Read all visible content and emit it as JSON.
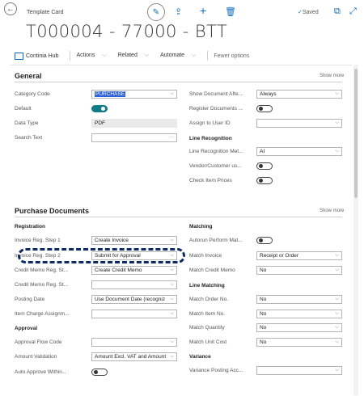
{
  "breadcrumb": "Template Card",
  "title": "T000004 - 77000 - BTT",
  "saved": "Saved",
  "actions": {
    "hub": "Continia Hub",
    "actions": "Actions",
    "related": "Related",
    "automate": "Automate",
    "fewer": "Fewer options"
  },
  "general": {
    "title": "General",
    "show_more": "Show more",
    "category_code_label": "Category Code",
    "category_code": "PURCHASE",
    "default_label": "Default",
    "data_type_label": "Data Type",
    "data_type": "PDF",
    "search_text_label": "Search Text",
    "show_doc_after_label": "Show Document Afte...",
    "show_doc_after": "Always",
    "register_docs_label": "Register Documents ...",
    "assign_user_label": "Assign to User ID",
    "line_recognition": "Line Recognition",
    "line_recog_method_label": "Line Recognition Met...",
    "line_recog_method": "AI",
    "vendor_customer_label": "Vendor/Customer us...",
    "check_item_prices_label": "Check Item Prices"
  },
  "purchase": {
    "title": "Purchase Documents",
    "show_more": "Show more",
    "registration": "Registration",
    "inv_step1_label": "Invoice Reg. Step 1",
    "inv_step1": "Create Invoice",
    "inv_step2_label": "Invoice Reg. Step 2",
    "inv_step2": "Submit for Approval",
    "cm_step1_label": "Credit Memo Reg. St...",
    "cm_step1": "Create Credit Memo",
    "cm_step2_label": "Credit Memo Reg. St...",
    "posting_date_label": "Posting Date",
    "posting_date": "Use Document Date (recogniz",
    "item_charge_label": "Item Charge Assignm...",
    "approval": "Approval",
    "approval_flow_label": "Approval Flow Code",
    "amount_validation_label": "Amount Validation",
    "amount_validation": "Amount Excl. VAT and Amount",
    "auto_approve_label": "Auto Approve Within...",
    "matching": "Matching",
    "autorun_label": "Autorun Perform Mat...",
    "match_invoice_label": "Match Invoice",
    "match_invoice": "Receipt or Order",
    "match_credit_label": "Match Credit Memo",
    "match_credit": "No",
    "line_matching": "Line Matching",
    "match_order_label": "Match Order No.",
    "match_order": "No",
    "match_item_label": "Match Item No.",
    "match_item": "No",
    "match_qty_label": "Match Quantity",
    "match_qty": "No",
    "match_unit_cost_label": "Match Unit Cost",
    "match_unit_cost": "No",
    "variance": "Variance",
    "variance_posting_label": "Variance Posting Acc..."
  },
  "toggles": {
    "default": true,
    "register_docs": false,
    "vendor_customer": false,
    "check_item_prices": false,
    "autorun": false,
    "auto_approve": false
  },
  "colors": {
    "accent": "#0f6cbd",
    "toggle_on": "#117b87",
    "highlight": "#0d2a66",
    "selection": "#2b60d6"
  }
}
